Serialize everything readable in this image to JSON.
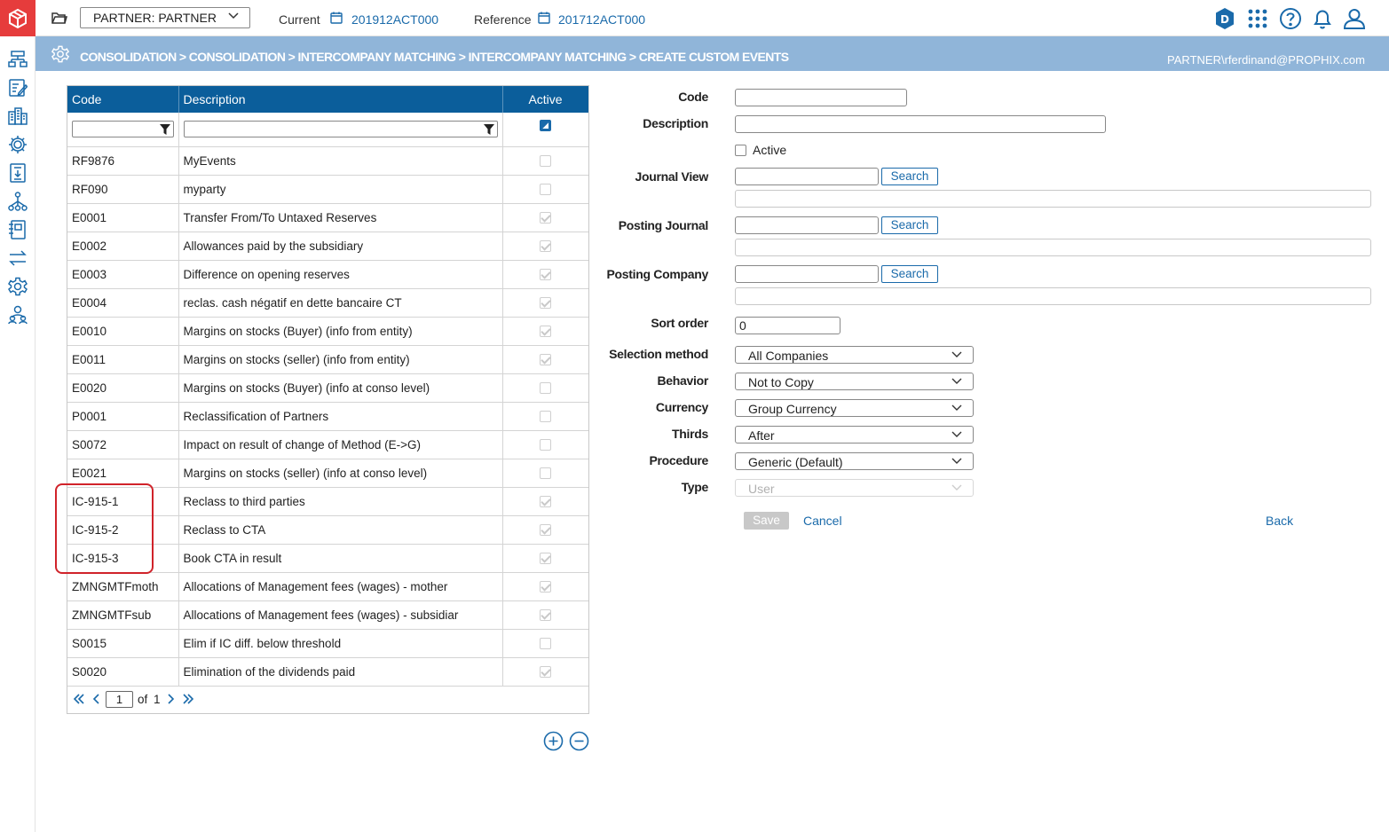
{
  "topbar": {
    "partner_select": "PARTNER: PARTNER",
    "current_label": "Current",
    "current_value": "201912ACT000",
    "reference_label": "Reference",
    "reference_value": "201712ACT000",
    "user_badge": "D",
    "icons": [
      "apps-grid-icon",
      "help-icon",
      "bell-icon",
      "user-icon"
    ]
  },
  "leftnav": {
    "icons": [
      "org-structure-icon",
      "edit-form-icon",
      "buildings-icon",
      "settings-cog-icon",
      "document-download-icon",
      "hierarchy-icon",
      "ledger-icon",
      "transfer-arrows-icon",
      "gears-icon",
      "users-group-icon"
    ]
  },
  "breadcrumb": {
    "text": "CONSOLIDATION > CONSOLIDATION > INTERCOMPANY MATCHING > INTERCOMPANY MATCHING > CREATE CUSTOM EVENTS",
    "user": "PARTNER\\rferdinand@PROPHIX.com"
  },
  "grid": {
    "columns": [
      "Code",
      "Description",
      "Active"
    ],
    "rows": [
      {
        "code": "RF9876",
        "description": "MyEvents",
        "active": false
      },
      {
        "code": "RF090",
        "description": "myparty",
        "active": false
      },
      {
        "code": "E0001",
        "description": "Transfer From/To Untaxed Reserves",
        "active": true
      },
      {
        "code": "E0002",
        "description": "Allowances paid by the subsidiary",
        "active": true
      },
      {
        "code": "E0003",
        "description": "Difference on opening reserves",
        "active": true
      },
      {
        "code": "E0004",
        "description": "reclas. cash négatif en dette bancaire CT",
        "active": true
      },
      {
        "code": "E0010",
        "description": "Margins on stocks (Buyer) (info from entity)",
        "active": true
      },
      {
        "code": "E0011",
        "description": "Margins on stocks (seller) (info from entity)",
        "active": true
      },
      {
        "code": "E0020",
        "description": "Margins on stocks (Buyer) (info at conso level)",
        "active": false
      },
      {
        "code": "P0001",
        "description": "Reclassification of Partners",
        "active": false
      },
      {
        "code": "S0072",
        "description": "Impact on result of change of Method (E->G)",
        "active": false
      },
      {
        "code": "E0021",
        "description": "Margins on stocks (seller) (info at conso level)",
        "active": false
      },
      {
        "code": "IC-915-1",
        "description": "Reclass to third parties",
        "active": true
      },
      {
        "code": "IC-915-2",
        "description": "Reclass to CTA",
        "active": true
      },
      {
        "code": "IC-915-3",
        "description": "Book CTA in result",
        "active": true
      },
      {
        "code": "ZMNGMTFmoth",
        "description": "Allocations of Management fees (wages) - mother",
        "active": true
      },
      {
        "code": "ZMNGMTFsub",
        "description": "Allocations of Management fees (wages) - subsidiar",
        "active": true
      },
      {
        "code": "S0015",
        "description": "Elim if IC diff. below threshold",
        "active": false
      },
      {
        "code": "S0020",
        "description": "Elimination of the dividends paid",
        "active": true
      }
    ],
    "pager": {
      "page": "1",
      "of_label": "of",
      "total": "1"
    }
  },
  "form": {
    "code_label": "Code",
    "description_label": "Description",
    "active_label": "Active",
    "journal_view_label": "Journal View",
    "posting_journal_label": "Posting Journal",
    "posting_company_label": "Posting Company",
    "search_label": "Search",
    "sort_order_label": "Sort order",
    "sort_order_value": "0",
    "selection_method_label": "Selection method",
    "selection_method_value": "All Companies",
    "behavior_label": "Behavior",
    "behavior_value": "Not to Copy",
    "currency_label": "Currency",
    "currency_value": "Group Currency",
    "thirds_label": "Thirds",
    "thirds_value": "After",
    "procedure_label": "Procedure",
    "procedure_value": "Generic (Default)",
    "type_label": "Type",
    "type_value": "User",
    "save_label": "Save",
    "cancel_label": "Cancel",
    "back_label": "Back"
  }
}
